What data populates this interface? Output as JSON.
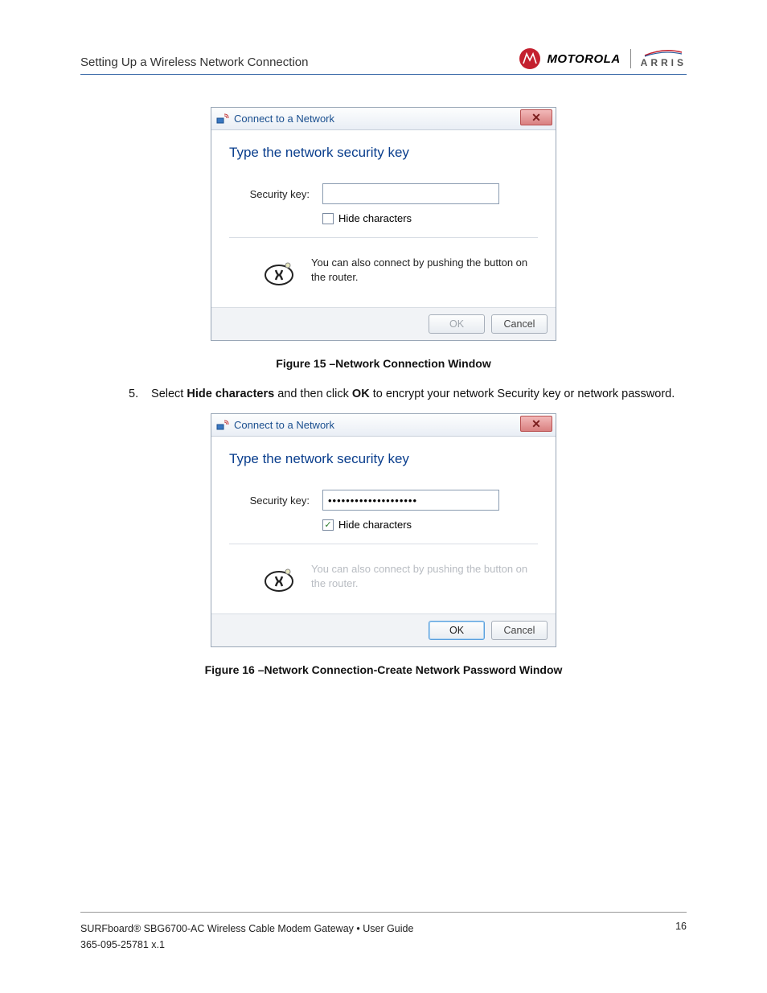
{
  "header": {
    "section_title": "Setting Up a Wireless Network Connection",
    "brand_motorola": "MOTOROLA",
    "brand_arris": "ARRIS"
  },
  "dialog1": {
    "title": "Connect to a Network",
    "close_glyph": "✕",
    "heading": "Type the network security key",
    "field_label": "Security key:",
    "input_value": "",
    "hide_checkbox_label": "Hide characters",
    "hide_checked": false,
    "wps_text": "You can also connect by pushing the button on the router.",
    "ok_label": "OK",
    "cancel_label": "Cancel"
  },
  "caption1": "Figure 15 –Network Connection Window",
  "step": {
    "number": "5.",
    "prefix": "Select ",
    "bold1": "Hide characters",
    "mid1": " and then click ",
    "bold2": "OK",
    "suffix": " to encrypt your network Security key or network password."
  },
  "dialog2": {
    "title": "Connect to a Network",
    "close_glyph": "✕",
    "heading": "Type the network security key",
    "field_label": "Security key:",
    "input_value": "••••••••••••••••••••",
    "hide_checkbox_label": "Hide characters",
    "hide_checked": true,
    "wps_text": "You can also connect by pushing the button on the router.",
    "ok_label": "OK",
    "cancel_label": "Cancel"
  },
  "caption2": "Figure 16 –Network Connection-Create Network Password Window",
  "footer": {
    "product_line": "SURFboard® SBG6700-AC Wireless Cable Modem Gateway • User Guide",
    "doc_id": "365-095-25781 x.1",
    "page_number": "16"
  }
}
